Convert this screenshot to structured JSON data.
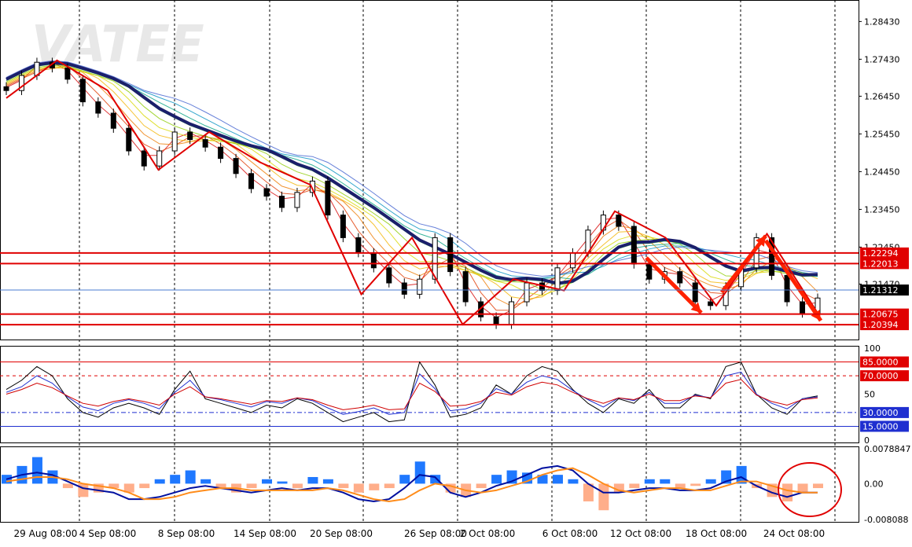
{
  "watermark": "VATEE",
  "colors": {
    "background": "#ffffff",
    "grid": "#000000",
    "up_candle": "#2e7d32",
    "down_candle": "#111111",
    "zigzag": "#e00000",
    "ma_slow": "#1b1f6b",
    "level_line": "#e00000",
    "current_price_bg": "#000000",
    "rsi_main": "#000000",
    "rsi_blue": "#1f2fd0",
    "rsi_red": "#d00000",
    "macd_pos": "#1f78ff",
    "macd_neg": "#ffae8a",
    "macd_line": "#0010a0",
    "macd_signal": "#ff8c1a"
  },
  "chart_data": [
    {
      "type": "candlestick",
      "title": "",
      "ylim": [
        1.2,
        1.29
      ],
      "y_ticks": [
        "1.28430",
        "1.27430",
        "1.26450",
        "1.25450",
        "1.24450",
        "1.23450",
        "1.22450",
        "1.21470"
      ],
      "x_ticks": [
        "29 Aug 08:00",
        "4 Sep 08:00",
        "8 Sep 08:00",
        "14 Sep 08:00",
        "20 Sep 08:00",
        "26 Sep 08:00",
        "2 Oct 08:00",
        "6 Oct 08:00",
        "12 Oct 08:00",
        "18 Oct 08:00",
        "24 Oct 08:00"
      ],
      "price_series": [
        1.266,
        1.27,
        1.2735,
        1.272,
        1.269,
        1.263,
        1.26,
        1.256,
        1.25,
        1.246,
        1.25,
        1.255,
        1.253,
        1.251,
        1.248,
        1.244,
        1.24,
        1.238,
        1.235,
        1.239,
        1.242,
        1.233,
        1.227,
        1.223,
        1.219,
        1.215,
        1.212,
        1.216,
        1.227,
        1.218,
        1.21,
        1.206,
        1.204,
        1.21,
        1.215,
        1.213,
        1.219,
        1.223,
        1.229,
        1.233,
        1.23,
        1.22,
        1.216,
        1.218,
        1.215,
        1.21,
        1.209,
        1.214,
        1.219,
        1.227,
        1.217,
        1.21,
        1.207,
        1.211
      ],
      "zigzag": [
        1.264,
        1.274,
        1.266,
        1.245,
        1.255,
        1.247,
        1.241,
        1.212,
        1.227,
        1.204,
        1.216,
        1.213,
        1.234,
        1.227,
        1.209,
        1.228,
        1.207
      ],
      "levels": [
        {
          "label": "1.22294",
          "value": 1.22294
        },
        {
          "label": "1.22013",
          "value": 1.22013
        },
        {
          "label": "1.20675",
          "value": 1.20675
        },
        {
          "label": "1.20394",
          "value": 1.20394
        }
      ],
      "current_price": {
        "label": "1.21312",
        "value": 1.21312
      },
      "annotations": [
        "down-arrow",
        "up-arrow",
        "down-arrow"
      ]
    },
    {
      "type": "line",
      "name": "RSI",
      "ylim": [
        0,
        100
      ],
      "y_ticks": [
        "100",
        "50",
        "0"
      ],
      "levels": [
        {
          "label": "85.0000",
          "value": 85
        },
        {
          "label": "70.0000",
          "value": 70
        },
        {
          "label": "30.0000",
          "value": 30
        },
        {
          "label": "15.0000",
          "value": 15
        }
      ],
      "series": [
        {
          "values": [
            55,
            65,
            80,
            70,
            45,
            30,
            25,
            35,
            40,
            35,
            28,
            55,
            75,
            45,
            40,
            35,
            30,
            38,
            35,
            45,
            40,
            30,
            20,
            25,
            30,
            20,
            22,
            85,
            60,
            25,
            28,
            35,
            60,
            50,
            70,
            80,
            75,
            55,
            40,
            30,
            45,
            40,
            55,
            35,
            35,
            50,
            45,
            80,
            85,
            50,
            35,
            28,
            45,
            48
          ]
        },
        {
          "values": [
            52,
            58,
            70,
            62,
            47,
            36,
            32,
            40,
            44,
            40,
            34,
            52,
            65,
            47,
            44,
            40,
            36,
            42,
            40,
            46,
            43,
            35,
            28,
            31,
            35,
            28,
            30,
            72,
            56,
            32,
            34,
            40,
            56,
            50,
            63,
            70,
            66,
            54,
            44,
            36,
            46,
            43,
            52,
            40,
            40,
            49,
            46,
            70,
            74,
            50,
            40,
            34,
            45,
            47
          ]
        },
        {
          "values": [
            50,
            55,
            62,
            57,
            48,
            40,
            37,
            42,
            45,
            42,
            38,
            50,
            58,
            47,
            45,
            42,
            39,
            43,
            42,
            46,
            44,
            38,
            33,
            35,
            38,
            33,
            34,
            62,
            53,
            37,
            38,
            42,
            52,
            49,
            58,
            63,
            60,
            52,
            45,
            40,
            46,
            44,
            50,
            43,
            43,
            48,
            46,
            62,
            66,
            49,
            42,
            38,
            44,
            46
          ]
        }
      ]
    },
    {
      "type": "bar",
      "name": "MACD",
      "ylim": [
        -0.008088,
        0.0078847
      ],
      "y_ticks": [
        "0.0078847",
        "0.00",
        "-0.008088"
      ],
      "histogram": [
        0.002,
        0.004,
        0.006,
        0.003,
        -0.001,
        -0.003,
        -0.002,
        -0.001,
        -0.002,
        -0.001,
        0.001,
        0.002,
        0.003,
        0.001,
        -0.001,
        -0.002,
        -0.001,
        0.001,
        0.0005,
        -0.001,
        0.0015,
        0.001,
        -0.001,
        -0.002,
        -0.0015,
        -0.001,
        0.002,
        0.005,
        0.002,
        -0.002,
        -0.003,
        -0.001,
        0.002,
        0.003,
        0.0025,
        0.002,
        0.002,
        0.001,
        -0.004,
        -0.006,
        -0.002,
        -0.001,
        0.001,
        0.001,
        -0.001,
        -0.0005,
        0.001,
        0.003,
        0.004,
        -0.001,
        -0.003,
        -0.004,
        -0.002,
        -0.001
      ],
      "series": [
        {
          "values": [
            0.001,
            0.002,
            0.0025,
            0.002,
            0.0005,
            -0.001,
            -0.0015,
            -0.002,
            -0.0035,
            -0.0035,
            -0.003,
            -0.002,
            -0.001,
            -0.0005,
            -0.001,
            -0.0015,
            -0.002,
            -0.0015,
            -0.001,
            -0.0015,
            -0.001,
            -0.001,
            -0.002,
            -0.0035,
            -0.004,
            -0.0035,
            -0.001,
            0.002,
            0.0015,
            -0.002,
            -0.003,
            -0.002,
            -0.0005,
            0.0005,
            0.002,
            0.0035,
            0.004,
            0.003,
            0.0,
            -0.002,
            -0.002,
            -0.0015,
            -0.001,
            -0.001,
            -0.0015,
            -0.0015,
            -0.001,
            0.0005,
            0.0015,
            -0.0005,
            -0.002,
            -0.003,
            -0.002,
            -0.002
          ]
        },
        {
          "values": [
            0.0005,
            0.001,
            0.0015,
            0.0015,
            0.001,
            0.0,
            -0.0005,
            -0.001,
            -0.002,
            -0.0035,
            -0.0035,
            -0.003,
            -0.002,
            -0.0015,
            -0.001,
            -0.001,
            -0.0015,
            -0.0015,
            -0.0015,
            -0.0015,
            -0.0015,
            -0.001,
            -0.0015,
            -0.0025,
            -0.0035,
            -0.004,
            -0.0035,
            -0.0015,
            0.0,
            -0.0005,
            -0.0015,
            -0.002,
            -0.0015,
            -0.0005,
            0.0005,
            0.002,
            0.003,
            0.0035,
            0.002,
            0.0,
            -0.0015,
            -0.002,
            -0.0015,
            -0.001,
            -0.001,
            -0.0015,
            -0.0015,
            -0.0005,
            0.0005,
            0.0005,
            -0.0005,
            -0.0015,
            -0.002,
            -0.002
          ]
        }
      ],
      "annotations": [
        "circle"
      ]
    }
  ]
}
